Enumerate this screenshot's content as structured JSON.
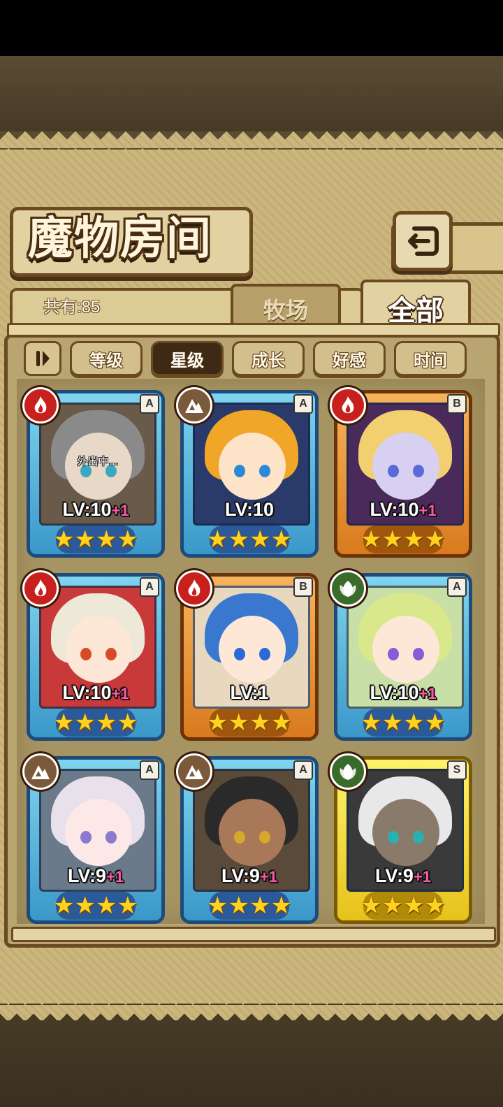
{
  "title": "魔物房间",
  "count_label": "共有:85",
  "tabs": {
    "ranch": "牧场",
    "all": "全部"
  },
  "sort_buttons": [
    "等级",
    "星级",
    "成长",
    "好感",
    "时间"
  ],
  "active_sort": "星级",
  "monsters": [
    {
      "element": "fire",
      "rank": "A",
      "frame": "blue",
      "level": "LV:10",
      "bonus": "+1",
      "stars": 4,
      "status": "外出中...",
      "hair": "#8a8a8a",
      "skin": "#e8d8c8",
      "bg": "#6a5a4a",
      "eye": "#3aa8c0"
    },
    {
      "element": "earth",
      "rank": "A",
      "frame": "blue",
      "level": "LV:10",
      "bonus": "",
      "stars": 4,
      "status": "",
      "hair": "#f2a628",
      "skin": "#fde3c8",
      "bg": "#2a3a6a",
      "eye": "#2a8ad8"
    },
    {
      "element": "fire",
      "rank": "B",
      "frame": "orange",
      "level": "LV:10",
      "bonus": "+1",
      "stars": 4,
      "status": "",
      "hair": "#f2d070",
      "skin": "#d8d0f0",
      "bg": "#4a2a5a",
      "eye": "#5a6ad8"
    },
    {
      "element": "fire",
      "rank": "A",
      "frame": "blue",
      "level": "LV:10",
      "bonus": "+1",
      "stars": 4,
      "status": "",
      "hair": "#eee8d8",
      "skin": "#fde8d8",
      "bg": "#c83a3a",
      "eye": "#d84a2a"
    },
    {
      "element": "fire",
      "rank": "B",
      "frame": "orange",
      "level": "LV:1",
      "bonus": "",
      "stars": 4,
      "status": "",
      "hair": "#3a78d0",
      "skin": "#fde8d8",
      "bg": "#e8d8c0",
      "eye": "#2a6ad8"
    },
    {
      "element": "nature",
      "rank": "A",
      "frame": "blue",
      "level": "LV:10",
      "bonus": "+1",
      "stars": 4,
      "status": "",
      "hair": "#d8e88a",
      "skin": "#fde8d8",
      "bg": "#c8e0a8",
      "eye": "#8a5ad8"
    },
    {
      "element": "earth",
      "rank": "A",
      "frame": "blue",
      "level": "LV:9",
      "bonus": "+1",
      "stars": 4,
      "status": "",
      "hair": "#e8e0ea",
      "skin": "#fde8e8",
      "bg": "#6a7a8a",
      "eye": "#8a7ad0"
    },
    {
      "element": "earth",
      "rank": "A",
      "frame": "blue",
      "level": "LV:9",
      "bonus": "+1",
      "stars": 4,
      "status": "",
      "hair": "#2a2a2a",
      "skin": "#a87858",
      "bg": "#5a4a3a",
      "eye": "#d8a82a"
    },
    {
      "element": "nature",
      "rank": "S",
      "frame": "gold",
      "level": "LV:9",
      "bonus": "+1",
      "stars": 4,
      "status": "",
      "hair": "#e8e8e8",
      "skin": "#8a7a6a",
      "bg": "#3a3a3a",
      "eye": "#2ab0b0"
    }
  ]
}
